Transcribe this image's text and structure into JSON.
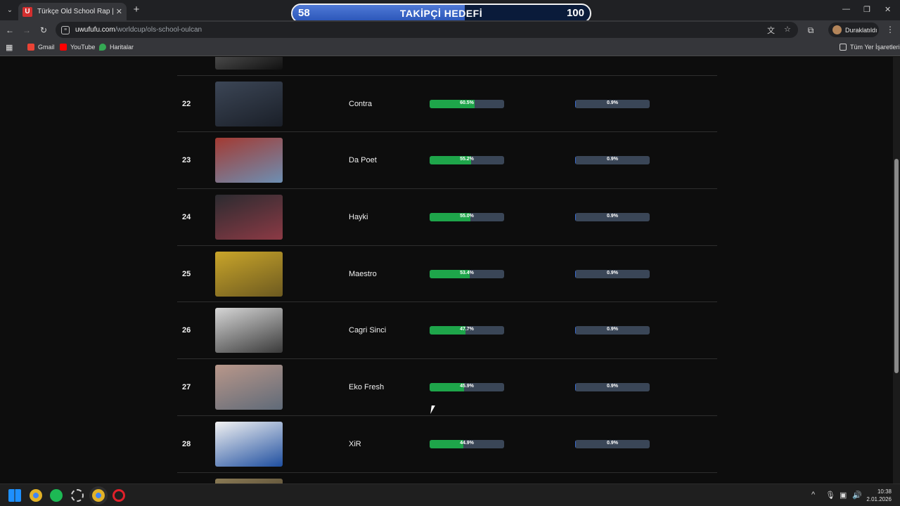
{
  "browser": {
    "tab": {
      "favicon_letter": "U",
      "title": "Türkçe Old School Rap | UwUFUFU"
    },
    "url_host": "uwufufu.com",
    "url_path": "/worldcup/ols-school-oulcan",
    "profile_label": "Duraklatıldı",
    "bookmarks": [
      {
        "label": "Gmail",
        "color": "#ea4335"
      },
      {
        "label": "YouTube",
        "color": "#ff0000"
      },
      {
        "label": "Haritalar",
        "color": "#34a853"
      }
    ],
    "all_bookmarks_label": "Tüm Yer İşaretleri"
  },
  "goal": {
    "current": "58",
    "title": "TAKİPÇİ HEDEFİ",
    "target": "100",
    "progress_fraction": 0.58
  },
  "rows": [
    {
      "rank": "",
      "name": "",
      "win": "",
      "win_value": 0,
      "champ": "",
      "champ_value": 0,
      "thumb": [
        "#7a7a7a",
        "#111111"
      ]
    },
    {
      "rank": "22",
      "name": "Contra",
      "win": "60.5%",
      "win_value": 60.5,
      "champ": "0.9%",
      "champ_value": 0.9,
      "thumb": [
        "#3c4656",
        "#1a1f28"
      ]
    },
    {
      "rank": "23",
      "name": "Da Poet",
      "win": "55.2%",
      "win_value": 55.2,
      "champ": "0.9%",
      "champ_value": 0.9,
      "thumb": [
        "#a33a32",
        "#6d8fb3"
      ]
    },
    {
      "rank": "24",
      "name": "Hayki",
      "win": "55.0%",
      "win_value": 55.0,
      "champ": "0.9%",
      "champ_value": 0.9,
      "thumb": [
        "#2b2b30",
        "#8c3a45"
      ]
    },
    {
      "rank": "25",
      "name": "Maestro",
      "win": "53.4%",
      "win_value": 53.4,
      "champ": "0.9%",
      "champ_value": 0.9,
      "thumb": [
        "#c9a52a",
        "#6d5a20"
      ]
    },
    {
      "rank": "26",
      "name": "Cagri Sinci",
      "win": "47.7%",
      "win_value": 47.7,
      "champ": "0.9%",
      "champ_value": 0.9,
      "thumb": [
        "#d6d6d6",
        "#3a3a3a"
      ]
    },
    {
      "rank": "27",
      "name": "Eko Fresh",
      "win": "45.9%",
      "win_value": 45.9,
      "champ": "0.9%",
      "champ_value": 0.9,
      "thumb": [
        "#b9978a",
        "#5f6a78"
      ]
    },
    {
      "rank": "28",
      "name": "XiR",
      "win": "44.9%",
      "win_value": 44.9,
      "champ": "0.9%",
      "champ_value": 0.9,
      "thumb": [
        "#f2f2f2",
        "#1f4fa0"
      ]
    },
    {
      "rank": "",
      "name": "",
      "win": "",
      "win_value": 0,
      "champ": "",
      "champ_value": 0,
      "thumb": [
        "#8a7a55",
        "#3a3020"
      ]
    }
  ],
  "taskbar": {
    "apps": [
      {
        "name": "start-icon",
        "color": "#1e90ff"
      },
      {
        "name": "chrome-icon",
        "color": "#e2b227"
      },
      {
        "name": "spotify-icon",
        "color": "#1db954"
      },
      {
        "name": "app-icon",
        "color": "#cfcfcf"
      },
      {
        "name": "chrome-active-icon",
        "color": "#e2b227"
      },
      {
        "name": "opera-icon",
        "color": "#e0202a"
      }
    ],
    "time": "10:38",
    "date": "2.01.2026"
  }
}
